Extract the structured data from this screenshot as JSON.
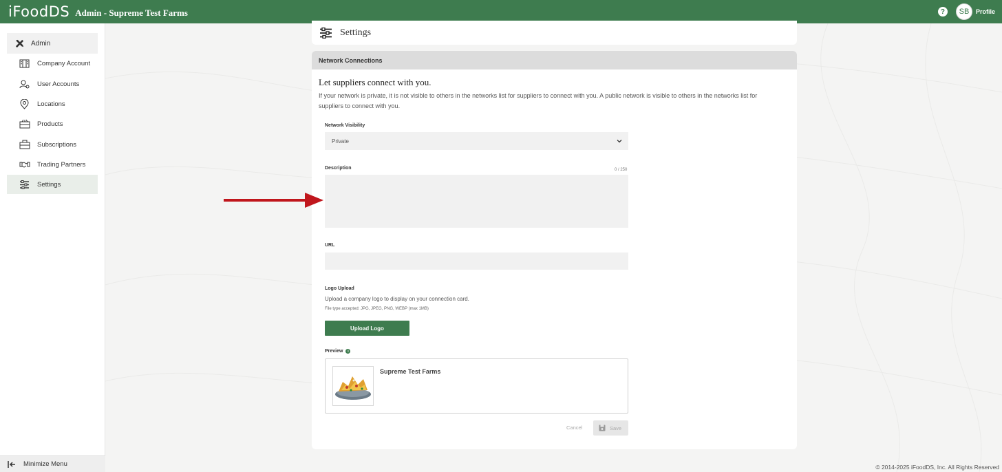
{
  "topbar": {
    "brand": "iFoodDS",
    "title": "Admin - Supreme Test Farms",
    "help_icon": "?",
    "avatar_initials": "SB",
    "profile_label": "Profile"
  },
  "sidebar": {
    "header": "Admin",
    "items": [
      {
        "label": "Company Account",
        "icon": "building-icon"
      },
      {
        "label": "User Accounts",
        "icon": "user-gear-icon"
      },
      {
        "label": "Locations",
        "icon": "map-pin-icon"
      },
      {
        "label": "Products",
        "icon": "crate-icon"
      },
      {
        "label": "Subscriptions",
        "icon": "briefcase-icon"
      },
      {
        "label": "Trading Partners",
        "icon": "handshake-icon"
      },
      {
        "label": "Settings",
        "icon": "sliders-icon",
        "active": true
      }
    ],
    "footer": "Minimize Menu"
  },
  "settings_card": {
    "title": "Settings"
  },
  "network": {
    "header": "Network Connections",
    "heading": "Let suppliers connect with you.",
    "description": "If your network is private, it is not visible to others in the networks list for suppliers to connect with you. A public network is visible to others in the networks list for suppliers to connect with you.",
    "visibility_label": "Network Visibility",
    "visibility_value": "Private",
    "description_label": "Description",
    "char_count": "0 / 250",
    "url_label": "URL",
    "logo_label": "Logo Upload",
    "logo_help": "Upload a company logo to display on your connection card.",
    "logo_types": "File type accepted: JPG, JPEG, PNG, WEBP (max 1MB)",
    "upload_button": "Upload Logo",
    "preview_label": "Preview",
    "preview_name": "Supreme Test Farms",
    "cancel_label": "Cancel",
    "save_label": "Save"
  },
  "footer": {
    "copyright": "© 2014-2025 iFoodDS, Inc. All Rights Reserved"
  },
  "colors": {
    "brand_green": "#3e7c4f",
    "annotation_arrow": "#c0161c"
  }
}
